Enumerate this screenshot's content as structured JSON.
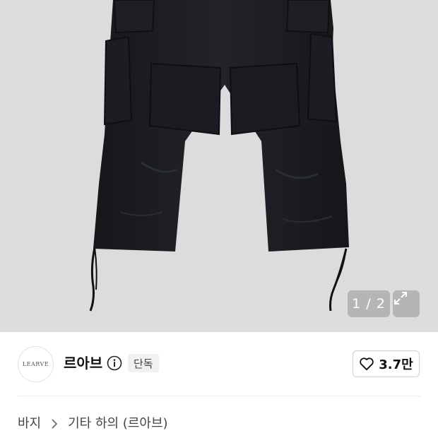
{
  "gallery": {
    "counter": "1 / 2",
    "image_subject": "black cargo shorts with drawstring hems",
    "background_color": "#dcdcdd"
  },
  "brand": {
    "logo_text": "LEARVE",
    "name": "르아브",
    "badge": "단독"
  },
  "like": {
    "count": "3.7만",
    "icon": "heart-outline-icon"
  },
  "breadcrumb": {
    "items": [
      "바지",
      "기타 하의 (르아브)"
    ],
    "separator_icon": "chevron-right-icon"
  }
}
